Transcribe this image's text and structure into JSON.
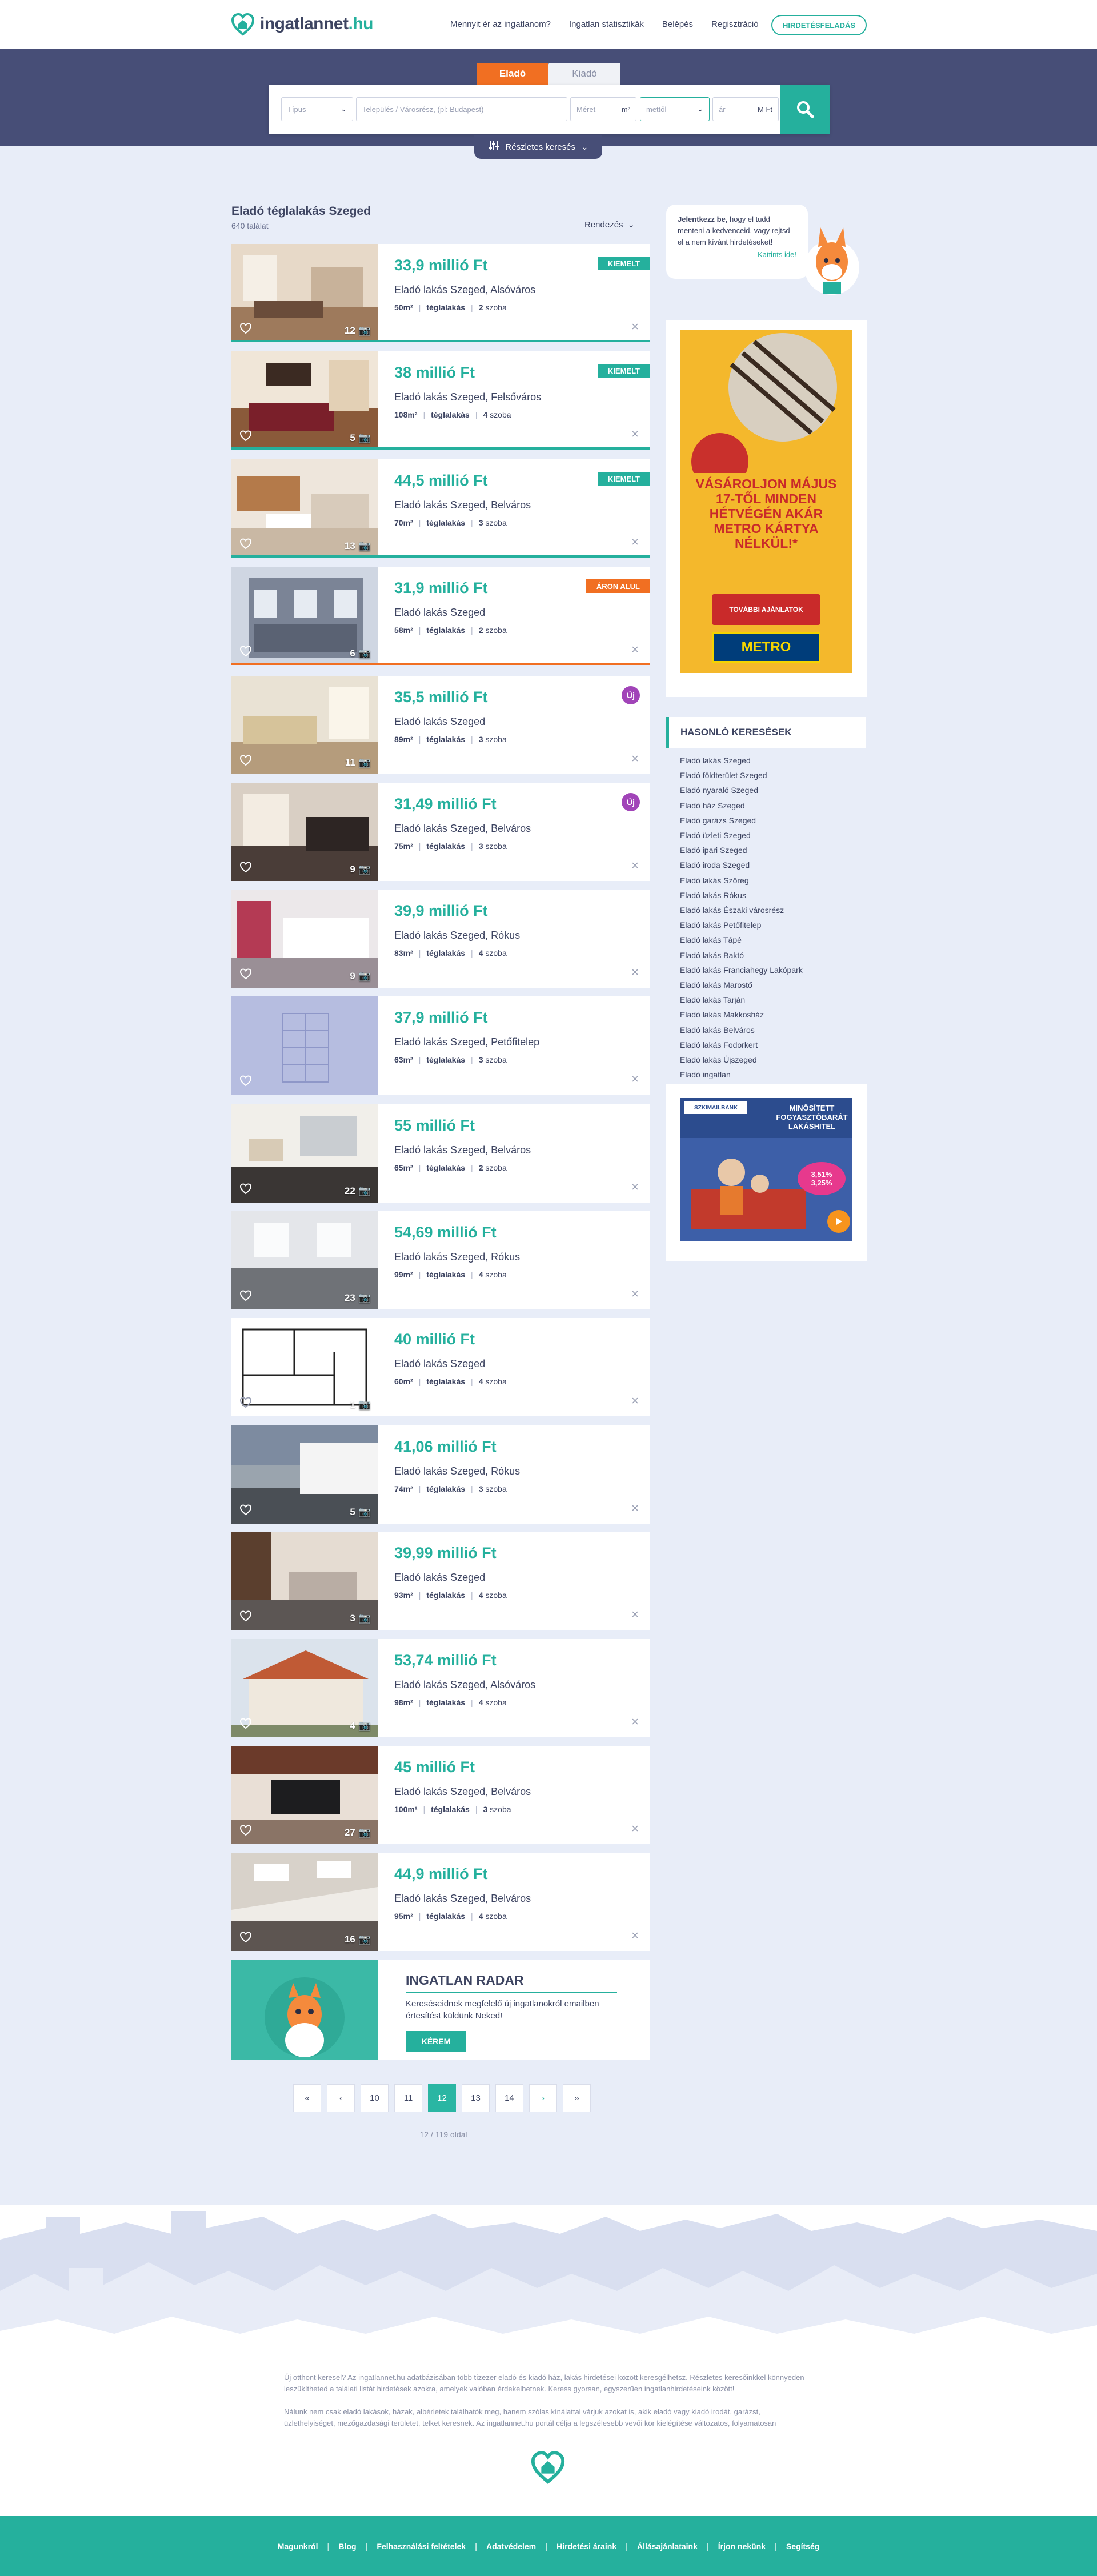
{
  "header": {
    "logo_text": "ingatlannet",
    "logo_suffix": ".hu",
    "nav": [
      "Mennyit ér az ingatlanom?",
      "Ingatlan statisztikák",
      "Belépés",
      "Regisztráció"
    ],
    "cta": "HIRDETÉSFELADÁS"
  },
  "search": {
    "tabs": [
      "Eladó",
      "Kiadó"
    ],
    "type_placeholder": "Típus",
    "location_placeholder": "Település / Városrész, (pl: Budapest)",
    "area_placeholder": "Méret",
    "area_unit": "m²",
    "price_from_placeholder": "mettől",
    "price_to_label": "ár",
    "price_unit": "M Ft",
    "advanced": "Részletes keresés"
  },
  "listing": {
    "title": "Eladó téglalakás Szeged",
    "count": "640 találat",
    "sort_label": "Rendezés",
    "items": [
      {
        "price": "33,9 millió Ft",
        "address": "Eladó lakás Szeged, Alsóváros",
        "area": "50m²",
        "type": "téglalakás",
        "rooms": "2",
        "rooms_label": "szoba",
        "photos": "12",
        "badge": "KIEMELT"
      },
      {
        "price": "38 millió Ft",
        "address": "Eladó lakás Szeged, Felsőváros",
        "area": "108m²",
        "type": "téglalakás",
        "rooms": "4",
        "rooms_label": "szoba",
        "photos": "5",
        "badge": "KIEMELT"
      },
      {
        "price": "44,5 millió Ft",
        "address": "Eladó lakás Szeged, Belváros",
        "area": "70m²",
        "type": "téglalakás",
        "rooms": "3",
        "rooms_label": "szoba",
        "photos": "13",
        "badge": "KIEMELT"
      },
      {
        "price": "31,9 millió Ft",
        "address": "Eladó lakás Szeged",
        "area": "58m²",
        "type": "téglalakás",
        "rooms": "2",
        "rooms_label": "szoba",
        "photos": "6",
        "badge": "ÁRON ALUL"
      },
      {
        "price": "35,5 millió Ft",
        "address": "Eladó lakás Szeged",
        "area": "89m²",
        "type": "téglalakás",
        "rooms": "3",
        "rooms_label": "szoba",
        "photos": "11",
        "badge": "Új"
      },
      {
        "price": "31,49 millió Ft",
        "address": "Eladó lakás Szeged, Belváros",
        "area": "75m²",
        "type": "téglalakás",
        "rooms": "3",
        "rooms_label": "szoba",
        "photos": "9",
        "badge": "Új"
      },
      {
        "price": "39,9 millió Ft",
        "address": "Eladó lakás Szeged, Rókus",
        "area": "83m²",
        "type": "téglalakás",
        "rooms": "4",
        "rooms_label": "szoba",
        "photos": "9",
        "badge": ""
      },
      {
        "price": "37,9 millió Ft",
        "address": "Eladó lakás Szeged, Petőfitelep",
        "area": "63m²",
        "type": "téglalakás",
        "rooms": "3",
        "rooms_label": "szoba",
        "photos": "",
        "badge": ""
      },
      {
        "price": "55 millió Ft",
        "address": "Eladó lakás Szeged, Belváros",
        "area": "65m²",
        "type": "téglalakás",
        "rooms": "2",
        "rooms_label": "szoba",
        "photos": "22",
        "badge": ""
      },
      {
        "price": "54,69 millió Ft",
        "address": "Eladó lakás Szeged, Rókus",
        "area": "99m²",
        "type": "téglalakás",
        "rooms": "4",
        "rooms_label": "szoba",
        "photos": "23",
        "badge": ""
      },
      {
        "price": "40 millió Ft",
        "address": "Eladó lakás Szeged",
        "area": "60m²",
        "type": "téglalakás",
        "rooms": "4",
        "rooms_label": "szoba",
        "photos": "1",
        "badge": ""
      },
      {
        "price": "41,06 millió Ft",
        "address": "Eladó lakás Szeged, Rókus",
        "area": "74m²",
        "type": "téglalakás",
        "rooms": "3",
        "rooms_label": "szoba",
        "photos": "5",
        "badge": ""
      },
      {
        "price": "39,99 millió Ft",
        "address": "Eladó lakás Szeged",
        "area": "93m²",
        "type": "téglalakás",
        "rooms": "4",
        "rooms_label": "szoba",
        "photos": "3",
        "badge": ""
      },
      {
        "price": "53,74 millió Ft",
        "address": "Eladó lakás Szeged, Alsóváros",
        "area": "98m²",
        "type": "téglalakás",
        "rooms": "4",
        "rooms_label": "szoba",
        "photos": "4",
        "badge": ""
      },
      {
        "price": "45 millió Ft",
        "address": "Eladó lakás Szeged, Belváros",
        "area": "100m²",
        "type": "téglalakás",
        "rooms": "3",
        "rooms_label": "szoba",
        "photos": "27",
        "badge": ""
      },
      {
        "price": "44,9 millió Ft",
        "address": "Eladó lakás Szeged, Belváros",
        "area": "95m²",
        "type": "téglalakás",
        "rooms": "4",
        "rooms_label": "szoba",
        "photos": "16",
        "badge": ""
      }
    ]
  },
  "radar": {
    "title": "INGATLAN RADAR",
    "text": "Kereséseidnek megfelelő új ingatlanokról emailben értesítést küldünk Neked!",
    "button": "KÉREM"
  },
  "pagination": {
    "pages": [
      "10",
      "11",
      "12",
      "13",
      "14"
    ],
    "current": "12",
    "info": "12 / 119 oldal"
  },
  "sidebar": {
    "login_bold": "Jelentkezz be,",
    "login_text": " hogy el tudd menteni a kedvenceid, vagy rejtsd el a nem kívánt hirdetéseket!",
    "login_link": "Kattints ide!",
    "ad1": {
      "headline": "VÁSÁROLJON MÁJUS 17-TŐL MINDEN HÉTVÉGÉN AKÁR METRO KÁRTYA NÉLKÜL!*",
      "button": "TOVÁBBI AJÁNLATOK",
      "brand": "METRO"
    },
    "similar_title": "HASONLÓ KERESÉSEK",
    "similar": [
      "Eladó lakás Szeged",
      "Eladó földterület Szeged",
      "Eladó nyaraló Szeged",
      "Eladó ház Szeged",
      "Eladó garázs Szeged",
      "Eladó üzleti Szeged",
      "Eladó ipari Szeged",
      "Eladó iroda Szeged",
      "Eladó lakás Szőreg",
      "Eladó lakás Rókus",
      "Eladó lakás Északi városrész",
      "Eladó lakás Petőfitelep",
      "Eladó lakás Tápé",
      "Eladó lakás Baktó",
      "Eladó lakás Franciahegy Lakópark",
      "Eladó lakás Marostő",
      "Eladó lakás Tarján",
      "Eladó lakás Makkosház",
      "Eladó lakás Belváros",
      "Eladó lakás Fodorkert",
      "Eladó lakás Újszeged",
      "Eladó ingatlan"
    ],
    "ad2": {
      "headline": "MINŐSÍTETT FOGYASZTÓBARÁT LAKÁSHITEL",
      "rate1": "3,51%",
      "rate2": "3,25%",
      "brand": "SZKIMAILBANK"
    }
  },
  "footer": {
    "text1": "Új otthont keresel? Az ingatlannet.hu adatbázisában több tízezer eladó és kiadó ház, lakás hirdetései között keresgélhetsz. Részletes keresőinkkel könnyeden leszűkítheted a találati listát hirdetések azokra, amelyek valóban érdekelhetnek. Keress gyorsan, egyszerűen ingatlanhirdetéseink között!",
    "text2": "Nálunk nem csak eladó lakások, házak, albérletek találhatók meg, hanem szólas kínálattal várjuk azokat is, akik eladó vagy kiadó irodát, garázst, üzlethelyiséget, mezőgazdasági területet, telket keresnek. Az ingatlannet.hu portál célja a legszélesebb vevői kör kielégítése változatos, folyamatosan",
    "links": [
      "Magunkról",
      "Blog",
      "Felhasználási feltételek",
      "Adatvédelem",
      "Hirdetési áraink",
      "Állásajánlataink",
      "Írjon nekünk",
      "Segítség"
    ]
  },
  "colors": {
    "accent": "#25b09d",
    "hero": "#474e77",
    "orange": "#f16f22",
    "purple": "#a144b8",
    "background": "#e8edf8"
  }
}
